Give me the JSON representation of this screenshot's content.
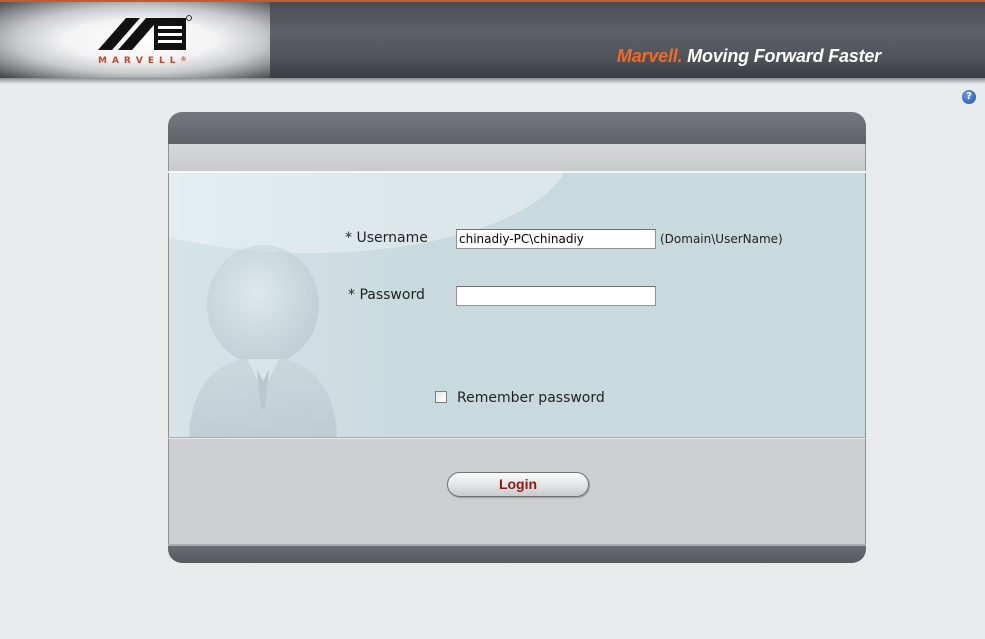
{
  "header": {
    "logo_text": "MARVELL",
    "logo_registered": "®",
    "tagline_brand": "Marvell.",
    "tagline_rest": " Moving Forward Faster"
  },
  "help": {
    "icon": "help-icon",
    "glyph": "?"
  },
  "login_form": {
    "username_label": "* Username",
    "username_value": "chinadiy-PC\\chinadiy",
    "username_hint": "(Domain\\UserName)",
    "password_label": "* Password",
    "password_value": "",
    "remember_label": "Remember password",
    "remember_checked": false,
    "login_button": "Login"
  },
  "colors": {
    "brand_orange": "#ee6a2a",
    "logo_red": "#c4442b",
    "login_text": "#8a1a10",
    "form_background": "#c8dade"
  }
}
